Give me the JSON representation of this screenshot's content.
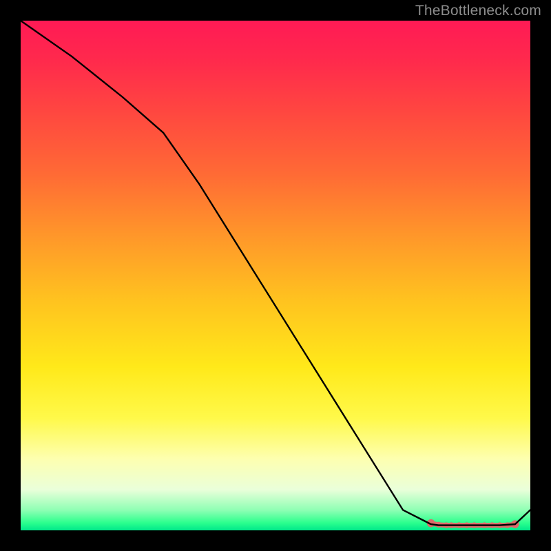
{
  "watermark": "TheBottleneck.com",
  "chart_data": {
    "type": "line",
    "title": "",
    "xlabel": "",
    "ylabel": "",
    "xlim": [
      0,
      100
    ],
    "ylim": [
      0,
      100
    ],
    "grid": false,
    "legend": false,
    "background_gradient": {
      "top": "#ff1a55",
      "mid": "#ffe91a",
      "bottom": "#00e88a"
    },
    "series": [
      {
        "name": "curve",
        "color": "#000000",
        "x": [
          0,
          10,
          20,
          28,
          35,
          45,
          55,
          65,
          75,
          80.5,
          82,
          88,
          94,
          97,
          100
        ],
        "y": [
          100,
          93,
          85,
          78,
          68,
          52,
          36,
          20,
          4,
          1.2,
          1.0,
          1.0,
          1.0,
          1.2,
          4
        ]
      }
    ],
    "markers": {
      "name": "floor-points",
      "color": "#dd6a6a",
      "x": [
        80.5,
        82,
        83.5,
        84.5,
        86,
        87.5,
        89,
        91,
        92.5,
        94,
        95.5,
        97
      ],
      "y": [
        1.4,
        1.1,
        1.0,
        1.0,
        1.0,
        1.0,
        1.0,
        1.0,
        1.0,
        1.0,
        1.0,
        1.2
      ]
    }
  }
}
